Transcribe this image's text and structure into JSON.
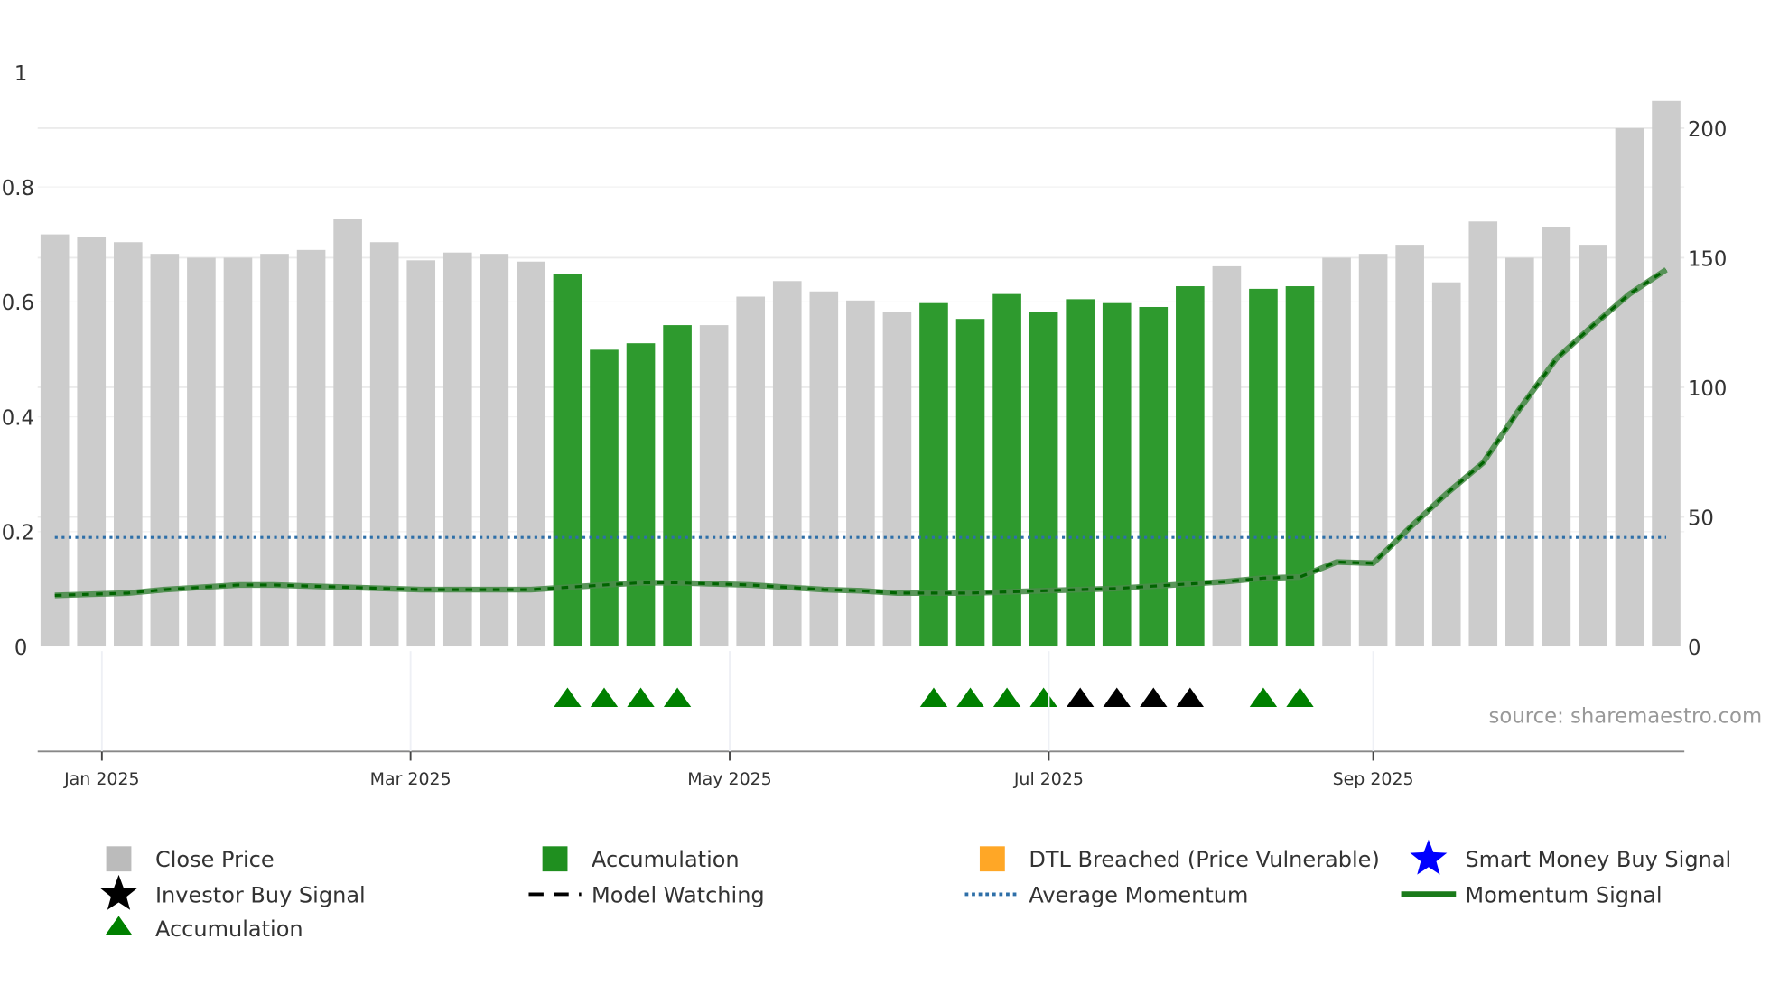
{
  "chart_data": {
    "type": "bar",
    "start_date": "2024-12-23",
    "interval_days": 7,
    "xticks": [
      {
        "date": "2025-01-01",
        "label": "Jan 2025"
      },
      {
        "date": "2025-03-01",
        "label": "Mar 2025"
      },
      {
        "date": "2025-05-01",
        "label": "May 2025"
      },
      {
        "date": "2025-07-01",
        "label": "Jul 2025"
      },
      {
        "date": "2025-09-01",
        "label": "Sep 2025"
      }
    ],
    "left_axis": {
      "ylim": [
        0,
        1
      ],
      "ticks": [
        "0",
        "0.2",
        "0.4",
        "0.6",
        "0.8",
        "1"
      ]
    },
    "right_axis": {
      "ylim": [
        0,
        221
      ],
      "ticks": [
        "0",
        "50",
        "100",
        "150",
        "200"
      ]
    },
    "close_price": [
      159,
      158,
      156,
      151.5,
      150,
      150,
      151.5,
      153,
      165,
      156,
      149,
      152,
      151.5,
      148.5,
      143.6,
      114.5,
      117,
      124,
      124,
      135,
      141,
      137,
      133.5,
      129,
      132.5,
      126.4,
      136,
      129,
      134,
      132.5,
      131,
      139,
      146.7,
      138,
      139,
      150,
      151.5,
      155,
      140.5,
      164,
      150,
      162,
      155,
      200,
      210.5
    ],
    "accumulation_bars": [
      15,
      16,
      17,
      18,
      25,
      26,
      27,
      28,
      29,
      30,
      31,
      32,
      34,
      35
    ],
    "momentum_signal": [
      0.089,
      0.091,
      0.093,
      0.099,
      0.103,
      0.107,
      0.107,
      0.105,
      0.103,
      0.101,
      0.099,
      0.099,
      0.099,
      0.099,
      0.103,
      0.107,
      0.111,
      0.111,
      0.109,
      0.107,
      0.103,
      0.099,
      0.097,
      0.093,
      0.093,
      0.093,
      0.095,
      0.097,
      0.099,
      0.101,
      0.105,
      0.109,
      0.113,
      0.119,
      0.121,
      0.147,
      0.145,
      0.207,
      0.266,
      0.32,
      0.414,
      0.501,
      0.559,
      0.614,
      0.656,
      0.694
    ],
    "average_momentum": 0.19,
    "accumulation_markers": [
      15,
      16,
      17,
      18,
      25,
      26,
      27,
      28,
      34,
      35
    ],
    "investor_markers": [
      29,
      30,
      31,
      32
    ],
    "source": "source: sharemaestro.com",
    "colors": {
      "close": "#cccccc",
      "accumulation": "#2e9a2e",
      "triangle": "#008000",
      "momentum": "#4a8c4a",
      "momentum_dash": "#006400",
      "avg": "#2e6fa8",
      "dtl": "#ffa726",
      "smart": "#0000ff"
    },
    "legend": [
      {
        "label": "Close Price",
        "marker": "gray-square"
      },
      {
        "label": "Accumulation",
        "marker": "green-square"
      },
      {
        "label": "DTL Breached (Price Vulnerable)",
        "marker": "orange-square"
      },
      {
        "label": "Smart Money Buy Signal",
        "marker": "blue-star"
      },
      {
        "label": "Investor Buy Signal",
        "marker": "black-star"
      },
      {
        "label": "Model Watching",
        "marker": "black-dash"
      },
      {
        "label": "Average Momentum",
        "marker": "blue-dots"
      },
      {
        "label": "Momentum Signal",
        "marker": "green-line"
      },
      {
        "label": "Accumulation",
        "marker": "green-triangle"
      }
    ]
  }
}
